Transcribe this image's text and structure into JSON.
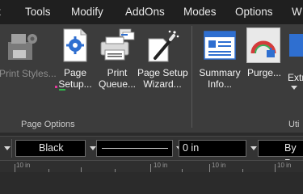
{
  "menubar": {
    "items": [
      "t",
      "Tools",
      "Modify",
      "AddOns",
      "Modes",
      "Options",
      "W"
    ]
  },
  "ribbon": {
    "buttons": [
      {
        "line1": "Print Styles...",
        "line2": "",
        "enabled": false,
        "icon": "printer-gear-icon"
      },
      {
        "line1": "Page",
        "line2": "Setup...",
        "enabled": true,
        "icon": "page-setup-icon"
      },
      {
        "line1": "Print",
        "line2": "Queue...",
        "enabled": true,
        "icon": "print-queue-icon"
      },
      {
        "line1": "Page Setup",
        "line2": "Wizard...",
        "enabled": true,
        "icon": "page-setup-wizard-icon"
      },
      {
        "line1": "Summary",
        "line2": "Info...",
        "enabled": true,
        "icon": "summary-info-icon"
      },
      {
        "line1": "Purge...",
        "line2": "",
        "enabled": true,
        "icon": "purge-icon"
      },
      {
        "line1": "Extr",
        "line2": "",
        "enabled": true,
        "icon": "extract-icon"
      }
    ],
    "groups": [
      {
        "label": "Page Options"
      },
      {
        "label": "Uti"
      }
    ]
  },
  "propbar": {
    "color_value": "Black",
    "thickness_value": "0 in",
    "by_value": "By P"
  },
  "ruler": {
    "labels": [
      "10 in",
      "10 in",
      "10 in",
      "10 in"
    ]
  },
  "colors": {
    "menubar_bg": "#1f1f1f",
    "ribbon_bg": "#3c3c3c",
    "accent_blue": "#2f6fd0",
    "purge_red": "#d43b3b"
  }
}
